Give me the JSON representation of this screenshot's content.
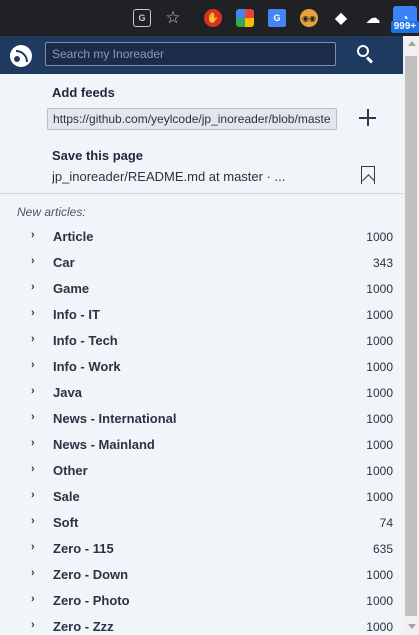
{
  "browser": {
    "extension_badge": "999+",
    "icons": [
      "translate-icon",
      "star-icon",
      "stop-icon",
      "multicolor-extension-icon",
      "google-translate-icon",
      "face-extension-icon",
      "diamond-icon",
      "cloud-icon",
      "inoreader-icon"
    ]
  },
  "header": {
    "search_placeholder": "Search my Inoreader"
  },
  "add_feeds": {
    "label": "Add feeds",
    "url": "https://github.com/yeylcode/jp_inoreader/blob/master/README.md"
  },
  "save_page": {
    "label": "Save this page",
    "title": "jp_inoreader/README.md at master · ..."
  },
  "new_articles_label": "New articles:",
  "feeds": [
    {
      "name": "Article",
      "count": "1000"
    },
    {
      "name": "Car",
      "count": "343"
    },
    {
      "name": "Game",
      "count": "1000"
    },
    {
      "name": "Info - IT",
      "count": "1000"
    },
    {
      "name": "Info - Tech",
      "count": "1000"
    },
    {
      "name": "Info - Work",
      "count": "1000"
    },
    {
      "name": "Java",
      "count": "1000"
    },
    {
      "name": "News - International",
      "count": "1000"
    },
    {
      "name": "News - Mainland",
      "count": "1000"
    },
    {
      "name": "Other",
      "count": "1000"
    },
    {
      "name": "Sale",
      "count": "1000"
    },
    {
      "name": "Soft",
      "count": "74"
    },
    {
      "name": "Zero - 115",
      "count": "635"
    },
    {
      "name": "Zero - Down",
      "count": "1000"
    },
    {
      "name": "Zero - Photo",
      "count": "1000"
    },
    {
      "name": "Zero - Zzz",
      "count": "1000"
    }
  ],
  "colors": {
    "header_bg": "#1f3a60",
    "panel_bg": "#f1f4f9",
    "text": "#2a3342"
  }
}
